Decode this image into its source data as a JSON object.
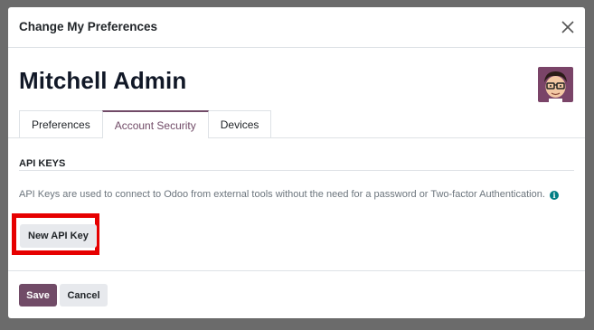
{
  "dialog": {
    "title": "Change My Preferences",
    "close_icon": "close-icon"
  },
  "user": {
    "name": "Mitchell Admin",
    "avatar_icon": "user-avatar"
  },
  "tabs": [
    {
      "label": "Preferences",
      "active": false
    },
    {
      "label": "Account Security",
      "active": true
    },
    {
      "label": "Devices",
      "active": false
    }
  ],
  "api_keys": {
    "section_title": "API KEYS",
    "description": "API Keys are used to connect to Odoo from external tools without the need for a password or Two-factor Authentication.",
    "info_icon": "info-icon",
    "new_key_label": "New API Key"
  },
  "footer": {
    "save_label": "Save",
    "cancel_label": "Cancel"
  },
  "colors": {
    "primary": "#714b67",
    "highlight": "#e60000",
    "info": "#017e84",
    "secondary_button": "#e7e9ed"
  }
}
